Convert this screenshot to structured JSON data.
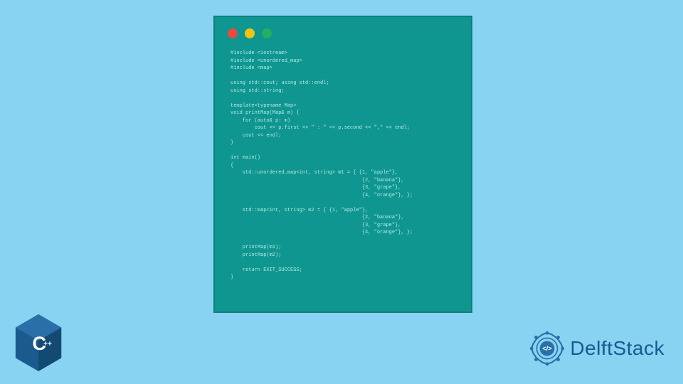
{
  "codewindow": {
    "dots": [
      "red",
      "yellow",
      "green"
    ],
    "code": "#include <iostream>\n#include <unordered_map>\n#include <map>\n\nusing std::cout; using std::endl;\nusing std::string;\n\ntemplate<typename Map>\nvoid printMap(Map& m) {\n    for (auto& p: m)\n        cout << p.first << \" : \" << p.second << \",\" << endl;\n    cout << endl;\n}\n\nint main()\n{\n    std::unordered_map<int, string> m1 = { {1, \"apple\"},\n                                            {2, \"banana\"},\n                                            {3, \"grape\"},\n                                            {4, \"orange\"}, };\n\n    std::map<int, string> m2 = { {1, \"apple\"},\n                                            {2, \"banana\"},\n                                            {3, \"grape\"},\n                                            {4, \"orange\"}, };\n\n    printMap(m1);\n    printMap(m2);\n\n    return EXIT_SUCCESS;\n}"
  },
  "branding": {
    "cpp_label": "C++",
    "delftstack_label": "DelftStack"
  },
  "colors": {
    "bg": "#88d2f2",
    "window_bg": "#0f9690",
    "cpp_blue": "#1a5a8e",
    "delft_blue": "#2a6fa8"
  }
}
